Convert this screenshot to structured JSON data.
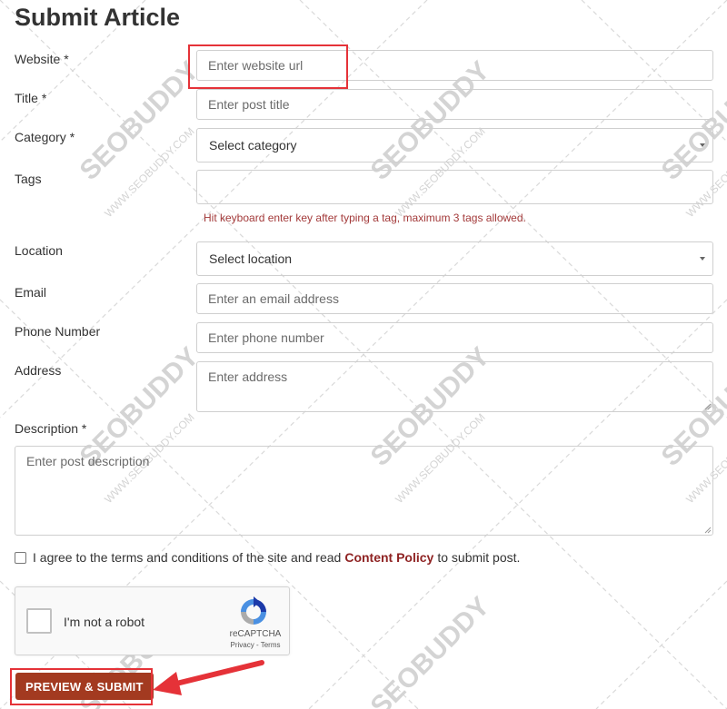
{
  "page_title": "Submit Article",
  "colors": {
    "accent": "#a33a20",
    "highlight": "#e53238",
    "link": "#8f2323",
    "hint": "#a33a3a"
  },
  "form": {
    "website": {
      "label": "Website *",
      "placeholder": "Enter website url"
    },
    "title": {
      "label": "Title *",
      "placeholder": "Enter post title"
    },
    "category": {
      "label": "Category *",
      "selected": "Select category"
    },
    "tags": {
      "label": "Tags",
      "value": "",
      "hint": "Hit keyboard enter key after typing a tag, maximum 3 tags allowed."
    },
    "location": {
      "label": "Location",
      "selected": "Select location"
    },
    "email": {
      "label": "Email",
      "placeholder": "Enter an email address"
    },
    "phone": {
      "label": "Phone Number",
      "placeholder": "Enter phone number"
    },
    "address": {
      "label": "Address",
      "placeholder": "Enter address"
    },
    "description": {
      "label": "Description *",
      "placeholder": "Enter post description"
    }
  },
  "agreement": {
    "prefix": "I agree to the terms and conditions of the site and read",
    "link": "Content Policy",
    "suffix": "to submit post.",
    "checked": false
  },
  "recaptcha": {
    "label": "I'm not a robot",
    "brand": "reCAPTCHA",
    "links": "Privacy - Terms"
  },
  "submit_button": {
    "label": "PREVIEW & SUBMIT"
  },
  "watermark": {
    "brand": "SEOBUDDY",
    "url": "WWW.SEOBUDDY.COM"
  }
}
